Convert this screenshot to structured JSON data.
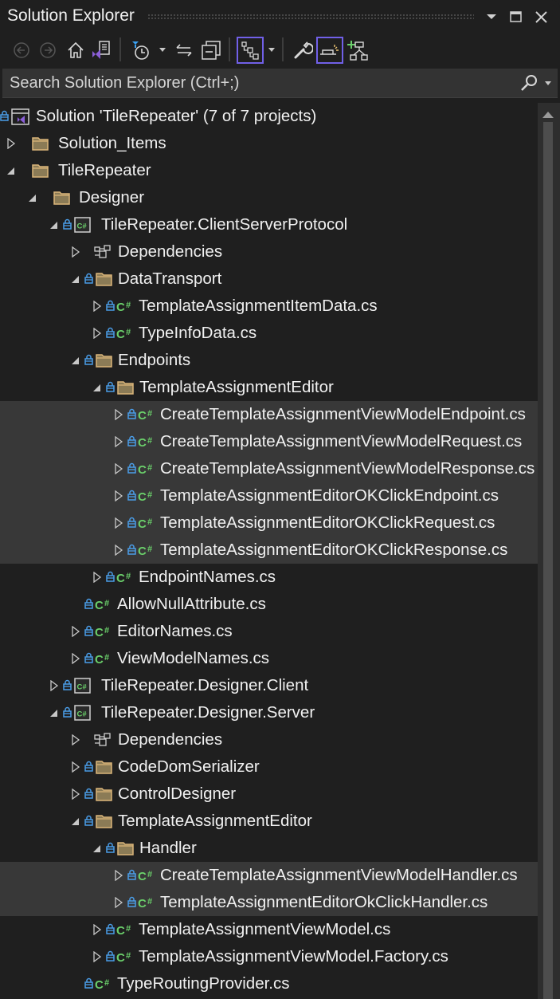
{
  "window": {
    "title": "Solution Explorer",
    "controls": [
      "window-position-dropdown",
      "maximize",
      "close"
    ]
  },
  "toolbar": {
    "buttons": [
      {
        "name": "back",
        "icon": "back-arrow-circle-icon",
        "enabled": false
      },
      {
        "name": "forward",
        "icon": "forward-arrow-circle-icon",
        "enabled": false
      },
      {
        "name": "home",
        "icon": "home-icon"
      },
      {
        "name": "switch-views",
        "icon": "vs-switch-views-icon"
      },
      {
        "name": "pending-changes-filter",
        "icon": "clock-filter-icon",
        "has_dropdown": true
      },
      {
        "name": "sync-with-active-document",
        "icon": "sync-arrows-icon"
      },
      {
        "name": "collapse-all",
        "icon": "collapse-all-icon"
      },
      {
        "name": "show-all-files",
        "icon": "tree-hierarchy-icon",
        "active": true,
        "has_dropdown": true
      },
      {
        "name": "properties",
        "icon": "wrench-icon"
      },
      {
        "name": "preview-selected-items",
        "icon": "preview-icon",
        "active": true
      },
      {
        "name": "add-to-diagram",
        "icon": "class-diagram-add-icon"
      }
    ],
    "accent": "#7160e8"
  },
  "search": {
    "placeholder": "Search Solution Explorer (Ctrl+;)"
  },
  "tree": {
    "rows": [
      {
        "label": "Solution 'TileRepeater' (7 of 7 projects)",
        "type": "solution",
        "level": 0,
        "expander": "none",
        "locked": true,
        "highlighted": false
      },
      {
        "label": "Solution_Items",
        "type": "folder",
        "level": 1,
        "expander": "collapsed",
        "locked": false,
        "highlighted": false
      },
      {
        "label": "TileRepeater",
        "type": "folder",
        "level": 1,
        "expander": "expanded",
        "locked": false,
        "highlighted": false
      },
      {
        "label": "Designer",
        "type": "folder",
        "level": 2,
        "expander": "expanded",
        "locked": false,
        "highlighted": false
      },
      {
        "label": "TileRepeater.ClientServerProtocol",
        "type": "csproj",
        "level": 3,
        "expander": "expanded",
        "locked": true,
        "highlighted": false
      },
      {
        "label": "Dependencies",
        "type": "dependencies",
        "level": 4,
        "expander": "collapsed",
        "locked": false,
        "highlighted": false
      },
      {
        "label": "DataTransport",
        "type": "folder",
        "level": 4,
        "expander": "expanded",
        "locked": true,
        "highlighted": false
      },
      {
        "label": "TemplateAssignmentItemData.cs",
        "type": "csfile",
        "level": 5,
        "expander": "collapsed",
        "locked": true,
        "highlighted": false
      },
      {
        "label": "TypeInfoData.cs",
        "type": "csfile",
        "level": 5,
        "expander": "collapsed",
        "locked": true,
        "highlighted": false
      },
      {
        "label": "Endpoints",
        "type": "folder",
        "level": 4,
        "expander": "expanded",
        "locked": true,
        "highlighted": false
      },
      {
        "label": "TemplateAssignmentEditor",
        "type": "folder",
        "level": 5,
        "expander": "expanded",
        "locked": true,
        "highlighted": false
      },
      {
        "label": "CreateTemplateAssignmentViewModelEndpoint.cs",
        "type": "csfile",
        "level": 6,
        "expander": "collapsed",
        "locked": true,
        "highlighted": true
      },
      {
        "label": "CreateTemplateAssignmentViewModelRequest.cs",
        "type": "csfile",
        "level": 6,
        "expander": "collapsed",
        "locked": true,
        "highlighted": true
      },
      {
        "label": "CreateTemplateAssignmentViewModelResponse.cs",
        "type": "csfile",
        "level": 6,
        "expander": "collapsed",
        "locked": true,
        "highlighted": true
      },
      {
        "label": "TemplateAssignmentEditorOKClickEndpoint.cs",
        "type": "csfile",
        "level": 6,
        "expander": "collapsed",
        "locked": true,
        "highlighted": true
      },
      {
        "label": "TemplateAssignmentEditorOKClickRequest.cs",
        "type": "csfile",
        "level": 6,
        "expander": "collapsed",
        "locked": true,
        "highlighted": true
      },
      {
        "label": "TemplateAssignmentEditorOKClickResponse.cs",
        "type": "csfile",
        "level": 6,
        "expander": "collapsed",
        "locked": true,
        "highlighted": true
      },
      {
        "label": "EndpointNames.cs",
        "type": "csfile",
        "level": 5,
        "expander": "collapsed",
        "locked": true,
        "highlighted": false
      },
      {
        "label": "AllowNullAttribute.cs",
        "type": "csfile",
        "level": 4,
        "expander": "none",
        "locked": true,
        "highlighted": false
      },
      {
        "label": "EditorNames.cs",
        "type": "csfile",
        "level": 4,
        "expander": "collapsed",
        "locked": true,
        "highlighted": false
      },
      {
        "label": "ViewModelNames.cs",
        "type": "csfile",
        "level": 4,
        "expander": "collapsed",
        "locked": true,
        "highlighted": false
      },
      {
        "label": "TileRepeater.Designer.Client",
        "type": "csproj",
        "level": 3,
        "expander": "collapsed",
        "locked": true,
        "highlighted": false
      },
      {
        "label": "TileRepeater.Designer.Server",
        "type": "csproj",
        "level": 3,
        "expander": "expanded",
        "locked": true,
        "highlighted": false
      },
      {
        "label": "Dependencies",
        "type": "dependencies",
        "level": 4,
        "expander": "collapsed",
        "locked": false,
        "highlighted": false
      },
      {
        "label": "CodeDomSerializer",
        "type": "folder",
        "level": 4,
        "expander": "collapsed",
        "locked": true,
        "highlighted": false
      },
      {
        "label": "ControlDesigner",
        "type": "folder",
        "level": 4,
        "expander": "collapsed",
        "locked": true,
        "highlighted": false
      },
      {
        "label": "TemplateAssignmentEditor",
        "type": "folder",
        "level": 4,
        "expander": "expanded",
        "locked": true,
        "highlighted": false
      },
      {
        "label": "Handler",
        "type": "folder",
        "level": 5,
        "expander": "expanded",
        "locked": true,
        "highlighted": false
      },
      {
        "label": "CreateTemplateAssignmentViewModelHandler.cs",
        "type": "csfile",
        "level": 6,
        "expander": "collapsed",
        "locked": true,
        "highlighted": true
      },
      {
        "label": "TemplateAssignmentEditorOkClickHandler.cs",
        "type": "csfile",
        "level": 6,
        "expander": "collapsed",
        "locked": true,
        "highlighted": true
      },
      {
        "label": "TemplateAssignmentViewModel.cs",
        "type": "csfile",
        "level": 5,
        "expander": "collapsed",
        "locked": true,
        "highlighted": false
      },
      {
        "label": "TemplateAssignmentViewModel.Factory.cs",
        "type": "csfile",
        "level": 5,
        "expander": "collapsed",
        "locked": true,
        "highlighted": false
      },
      {
        "label": "TypeRoutingProvider.cs",
        "type": "csfile",
        "level": 4,
        "expander": "none",
        "locked": true,
        "highlighted": false
      }
    ]
  },
  "colors": {
    "background": "#1f1f1f",
    "highlight_row": "#383838",
    "folder": "#dcb67a",
    "folder_fill": "#8b7b56",
    "lock": "#4a9de8",
    "csharp": "#6bd06b",
    "vs_purple": "#8b5fd8"
  }
}
